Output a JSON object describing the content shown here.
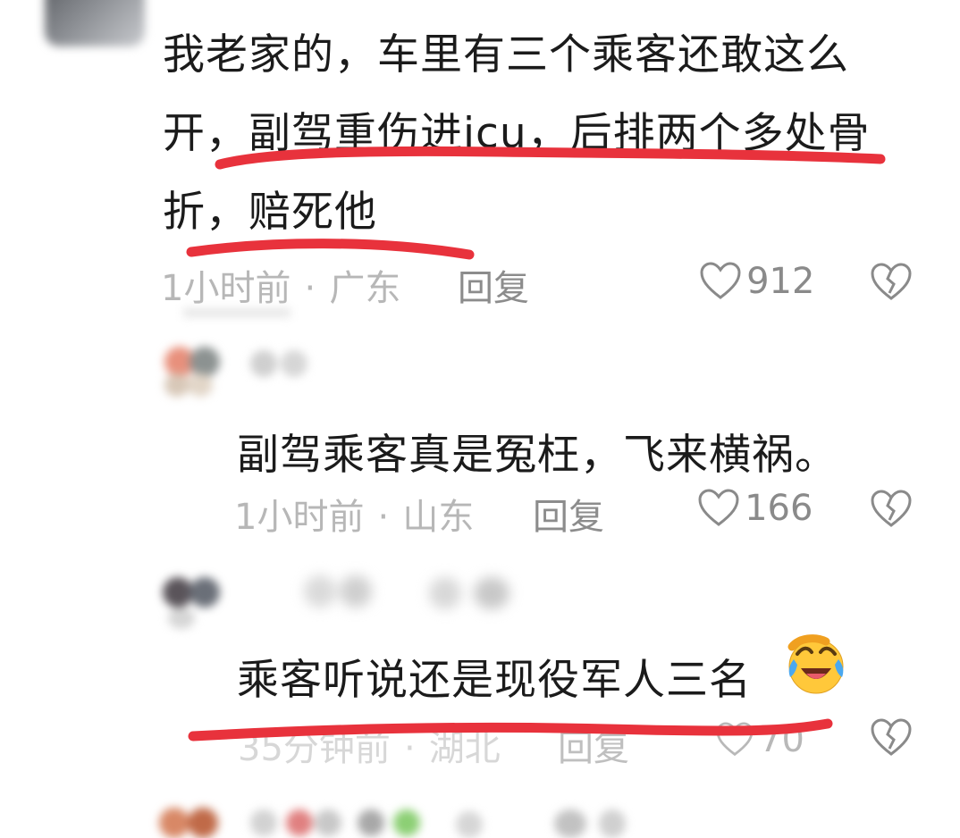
{
  "comments": [
    {
      "lines": [
        "我老家的，车里有三个乘客还敢这么",
        "开，副驾重伤进icu，后排两个多处骨",
        "折，赔死他"
      ],
      "time": "1小时前",
      "separator": "·",
      "location": "广东",
      "reply_label": "回复",
      "likes": "912"
    },
    {
      "text": "副驾乘客真是冤枉，飞来横祸。",
      "time": "1小时前",
      "separator": "·",
      "location": "山东",
      "reply_label": "回复",
      "likes": "166"
    },
    {
      "text": "乘客听说还是现役军人三名",
      "time": "35分钟前",
      "separator": "·",
      "location": "湖北",
      "reply_label": "回复",
      "likes": "70",
      "emoji": "face-with-tears-of-joy"
    }
  ],
  "icons": {
    "like": "heart-outline-icon",
    "dislike": "broken-heart-icon"
  },
  "colors": {
    "annotation_red": "#e8323c",
    "meta_gray": "#b7b7b7"
  }
}
